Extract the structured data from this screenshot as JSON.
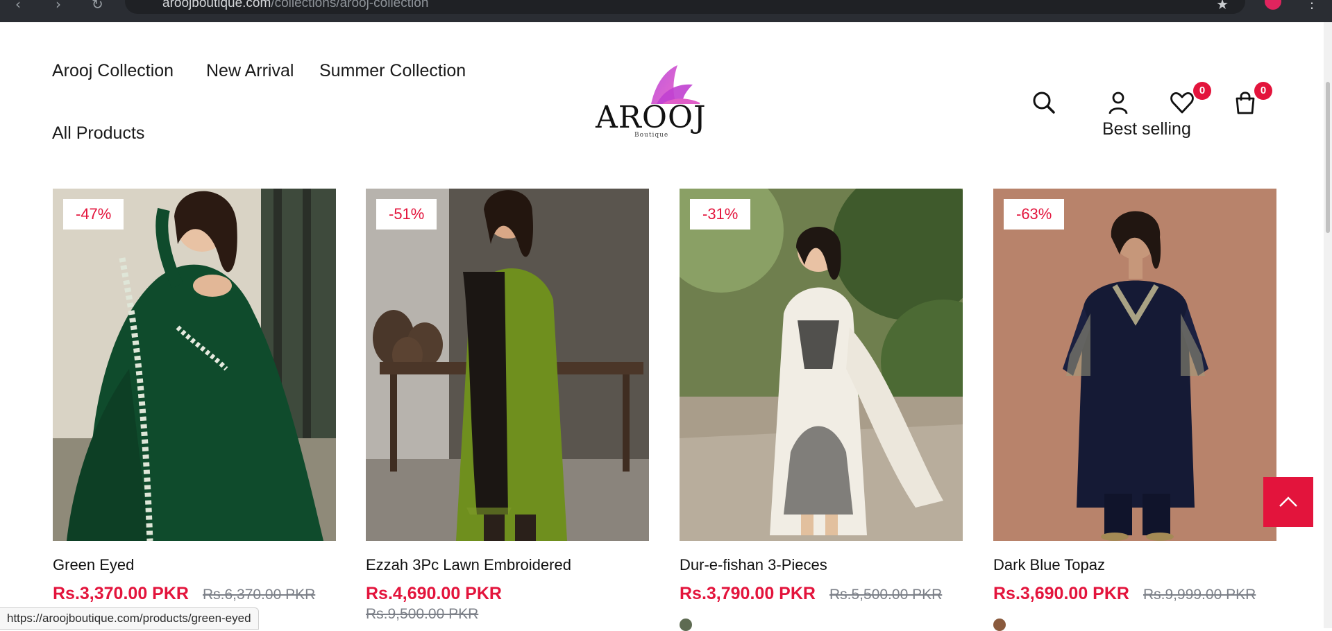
{
  "browser": {
    "url_host": "aroojboutique.com",
    "url_path": "/collections/arooj-collection",
    "status_link": "https://aroojboutique.com/products/green-eyed"
  },
  "header": {
    "menu": [
      "Arooj Collection",
      "New Arrival",
      "Summer Collection",
      "All Products"
    ],
    "logo_text": "AROOJ",
    "logo_subtext": "Boutique",
    "wishlist_count": "0",
    "cart_count": "0",
    "sort_label": "Best selling"
  },
  "icons": {
    "search": "search-icon",
    "account": "user-icon",
    "wishlist": "heart-icon",
    "cart": "bag-icon",
    "back_to_top": "chevron-up-icon"
  },
  "colors": {
    "accent": "#e3143c",
    "old_price": "#7c8088"
  },
  "products": [
    {
      "name": "Green Eyed",
      "discount": "-47%",
      "price": "Rs.3,370.00 PKR",
      "compare_price": "Rs.6,370.00 PKR"
    },
    {
      "name": "Ezzah 3Pc Lawn Embroidered",
      "discount": "-51%",
      "price": "Rs.4,690.00 PKR",
      "compare_price": "Rs.9,500.00 PKR"
    },
    {
      "name": "Dur-e-fishan 3-Pieces",
      "discount": "-31%",
      "price": "Rs.3,790.00 PKR",
      "compare_price": "Rs.5,500.00 PKR"
    },
    {
      "name": "Dark Blue Topaz",
      "discount": "-63%",
      "price": "Rs.3,690.00 PKR",
      "compare_price": "Rs.9,999.00 PKR"
    }
  ]
}
